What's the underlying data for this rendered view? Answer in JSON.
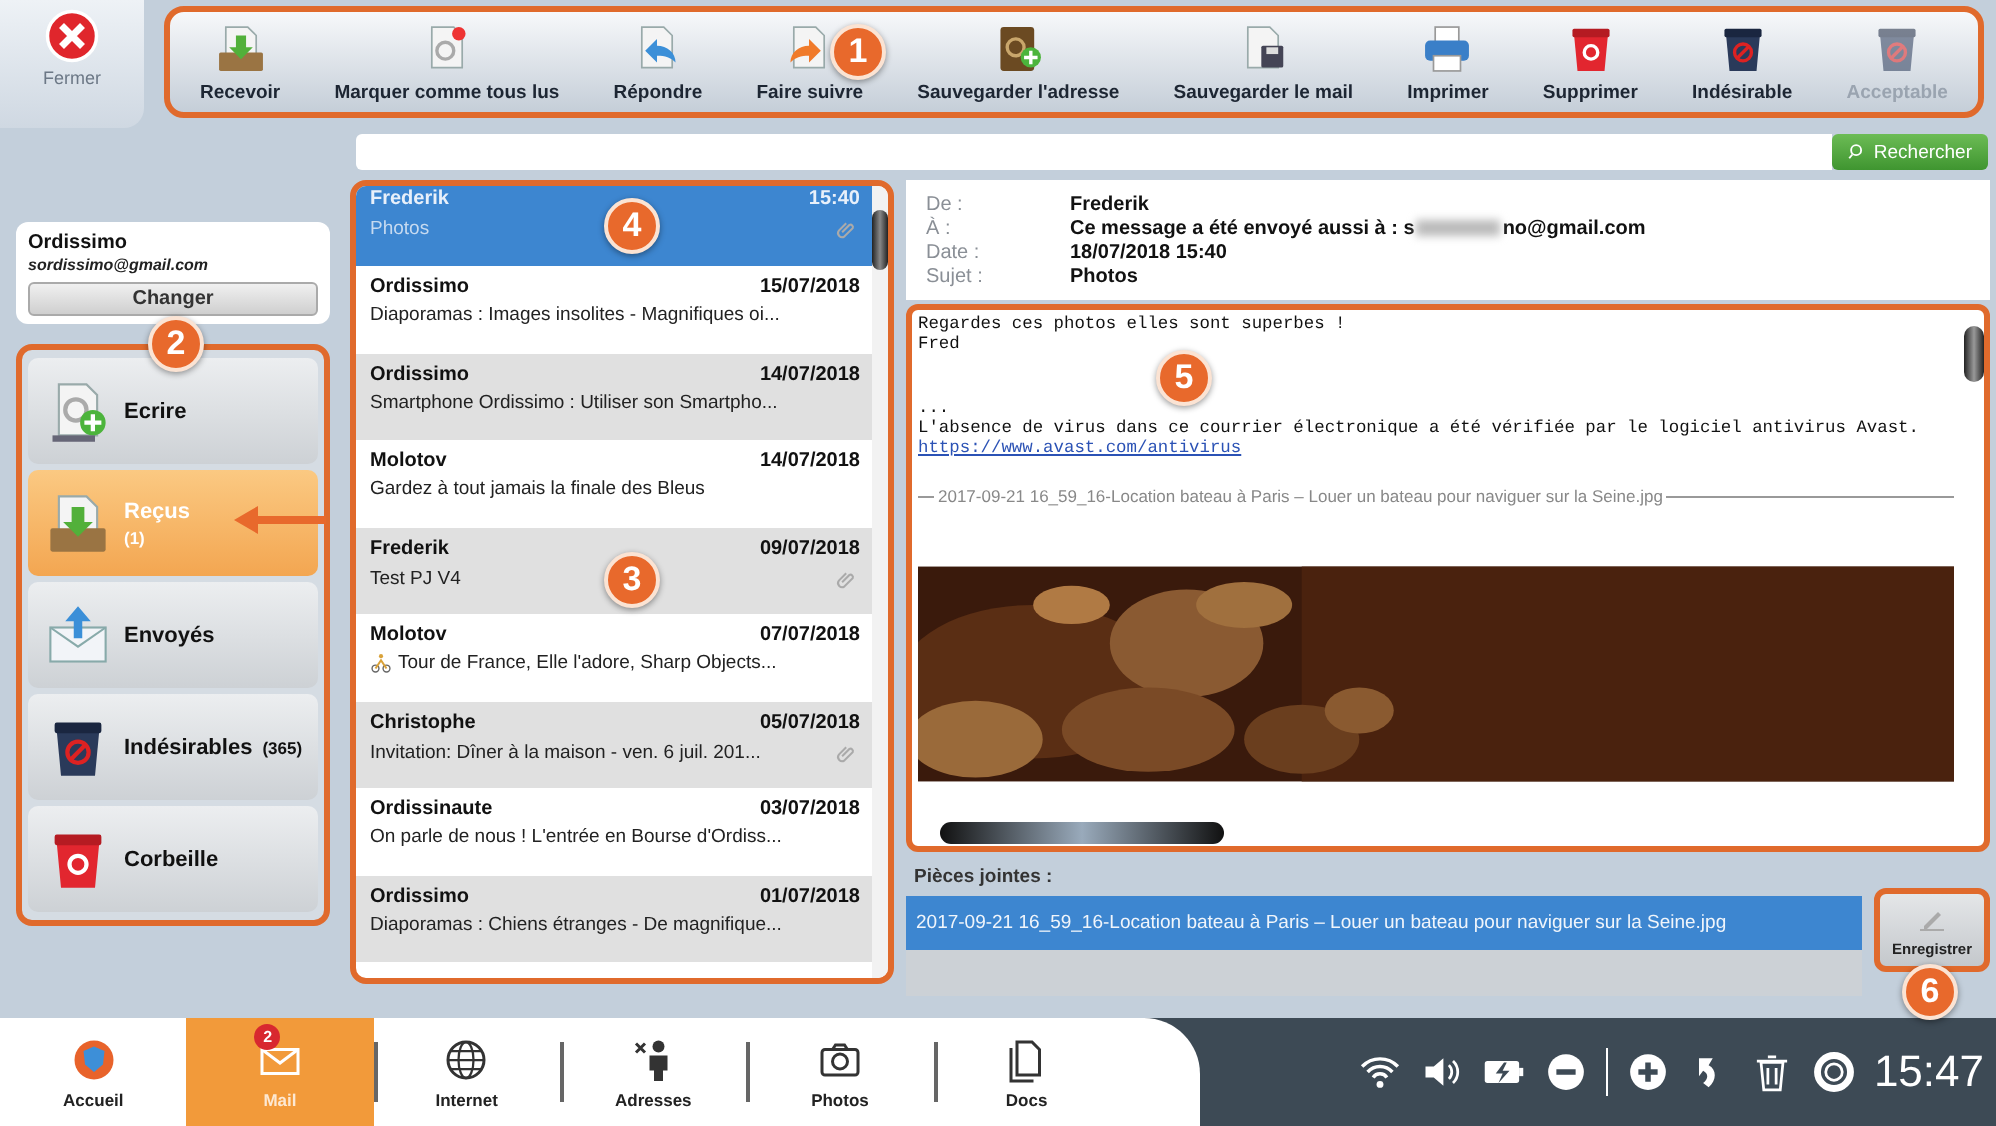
{
  "close_button": {
    "label": "Fermer"
  },
  "toolbar": {
    "callout": "1",
    "buttons": [
      {
        "kind": "receive",
        "label": "Recevoir",
        "disabled": false
      },
      {
        "kind": "mark_read",
        "label": "Marquer comme tous lus",
        "disabled": false
      },
      {
        "kind": "reply",
        "label": "Répondre",
        "disabled": false
      },
      {
        "kind": "forward",
        "label": "Faire suivre",
        "disabled": false
      },
      {
        "kind": "save_address",
        "label": "Sauvegarder l'adresse",
        "disabled": false
      },
      {
        "kind": "save_mail",
        "label": "Sauvegarder le mail",
        "disabled": false
      },
      {
        "kind": "print",
        "label": "Imprimer",
        "disabled": false
      },
      {
        "kind": "delete",
        "label": "Supprimer",
        "disabled": false
      },
      {
        "kind": "spam",
        "label": "Indésirable",
        "disabled": false
      },
      {
        "kind": "accept",
        "label": "Acceptable",
        "disabled": true
      }
    ]
  },
  "search": {
    "button": "Rechercher"
  },
  "account": {
    "name": "Ordissimo",
    "email": "sordissimo@gmail.com",
    "button": "Changer"
  },
  "folders": {
    "callout": "2",
    "items": [
      {
        "kind": "compose",
        "label": "Ecrire",
        "selected": false
      },
      {
        "kind": "inbox",
        "label": "Reçus",
        "count": "(1)",
        "selected": true
      },
      {
        "kind": "sent",
        "label": "Envoyés",
        "selected": false
      },
      {
        "kind": "spam",
        "label": "Indésirables",
        "count": "(365)",
        "selected": false
      },
      {
        "kind": "trash",
        "label": "Corbeille",
        "selected": false
      }
    ]
  },
  "messages": {
    "callout_list": "3",
    "callout_selected": "4",
    "items": [
      {
        "sender": "Frederik",
        "date": "15:40",
        "subject": "Photos",
        "attachment": true,
        "bike_icon": false,
        "selected": true
      },
      {
        "sender": "Ordissimo",
        "date": "15/07/2018",
        "subject": "Diaporamas : Images insolites - Magnifiques oi...",
        "attachment": false,
        "bike_icon": false,
        "selected": false
      },
      {
        "sender": "Ordissimo",
        "date": "14/07/2018",
        "subject": "Smartphone Ordissimo : Utiliser son Smartpho...",
        "attachment": false,
        "bike_icon": false,
        "selected": false
      },
      {
        "sender": "Molotov",
        "date": "14/07/2018",
        "subject": "Gardez à tout jamais la finale des Bleus",
        "attachment": false,
        "bike_icon": false,
        "selected": false
      },
      {
        "sender": "Frederik",
        "date": "09/07/2018",
        "subject": "Test PJ V4",
        "attachment": true,
        "bike_icon": false,
        "selected": false
      },
      {
        "sender": "Molotov",
        "date": "07/07/2018",
        "subject": "Tour de France, Elle l'adore, Sharp Objects...",
        "attachment": false,
        "bike_icon": true,
        "selected": false
      },
      {
        "sender": "Christophe",
        "date": "05/07/2018",
        "subject": "Invitation: Dîner à la maison - ven. 6 juil. 201...",
        "attachment": true,
        "bike_icon": false,
        "selected": false
      },
      {
        "sender": "Ordissinaute",
        "date": "03/07/2018",
        "subject": "On parle de nous ! L'entrée en Bourse d'Ordiss...",
        "attachment": false,
        "bike_icon": false,
        "selected": false
      },
      {
        "sender": "Ordissimo",
        "date": "01/07/2018",
        "subject": "Diaporamas : Chiens étranges - De magnifique...",
        "attachment": false,
        "bike_icon": false,
        "selected": false
      }
    ]
  },
  "message": {
    "headers": [
      {
        "label": "De :",
        "value": "Frederik"
      },
      {
        "label": "À :",
        "value": "Ce message a été envoyé aussi à : s",
        "redacted_tail": "no@gmail.com"
      },
      {
        "label": "Date :",
        "value": "18/07/2018 15:40"
      },
      {
        "label": "Sujet :",
        "value": "Photos"
      }
    ],
    "callout": "5",
    "body": [
      {
        "kind": "paragraph",
        "lines": [
          {
            "kind": "text",
            "text": "Regardes ces photos elles sont superbes !"
          },
          {
            "kind": "text",
            "text": "Fred"
          }
        ]
      },
      {
        "kind": "paragraph",
        "lines": [
          {
            "kind": "text",
            "text": "..."
          },
          {
            "kind": "text",
            "text": "L'absence de virus dans ce courrier électronique a été vérifiée par le logiciel antivirus Avast."
          },
          {
            "kind": "link",
            "text": "https://www.avast.com/antivirus"
          }
        ]
      },
      {
        "kind": "divider",
        "text": "2017-09-21 16_59_16-Location bateau à Paris – Louer un bateau pour naviguer sur la Seine.jpg"
      },
      {
        "kind": "picture"
      }
    ]
  },
  "attachments": {
    "label": "Pièces jointes :",
    "items": [
      {
        "name": "2017-09-21 16_59_16-Location bateau à Paris – Louer un bateau pour naviguer sur la Seine.jpg",
        "selected": true
      }
    ],
    "save_button": "Enregistrer",
    "callout": "6"
  },
  "taskbar": {
    "apps": [
      {
        "kind": "home",
        "label": "Accueil",
        "selected": false
      },
      {
        "kind": "mail",
        "label": "Mail",
        "badge": "2",
        "selected": true
      },
      {
        "kind": "internet",
        "label": "Internet",
        "selected": false
      },
      {
        "kind": "contacts",
        "label": "Adresses",
        "selected": false
      },
      {
        "kind": "photos",
        "label": "Photos",
        "selected": false
      },
      {
        "kind": "docs",
        "label": "Docs",
        "selected": false
      }
    ],
    "time": "15:47"
  }
}
